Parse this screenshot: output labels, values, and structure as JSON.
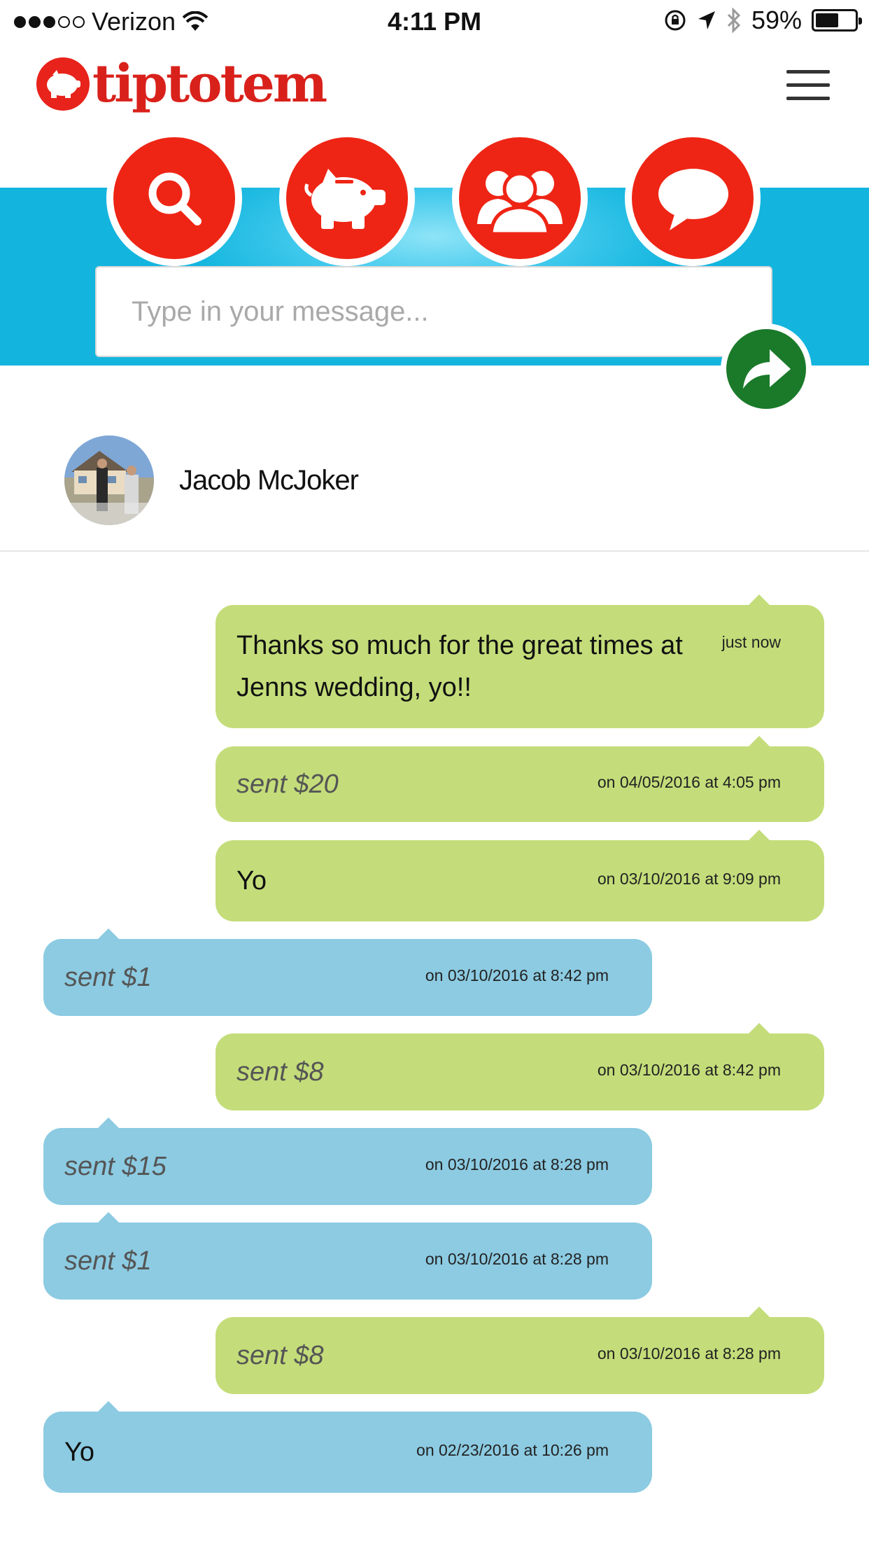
{
  "status_bar": {
    "carrier": "Verizon",
    "time": "4:11 PM",
    "battery": "59%",
    "battery_level": 0.59,
    "signal_bars": 3,
    "signal_total": 5
  },
  "header": {
    "logo_text": "tiptotem"
  },
  "compose": {
    "placeholder": "Type in your message..."
  },
  "contact": {
    "name": "Jacob McJoker"
  },
  "colors": {
    "brand_red": "#ee2515",
    "band_blue": "#13b5de",
    "outgoing_bubble": "#c4dd7a",
    "incoming_bubble": "#8ccbe2",
    "send_green": "#1a7a2a"
  },
  "nav_icons": [
    "search-icon",
    "piggy-bank-icon",
    "group-icon",
    "chat-icon"
  ],
  "messages": [
    {
      "direction": "out",
      "text": "Thanks so much for the great times at Jenns wedding, yo!!",
      "time": "just now"
    },
    {
      "direction": "out",
      "text": "sent $20",
      "time": "on 04/05/2016 at 4:05 pm"
    },
    {
      "direction": "out",
      "text": "Yo",
      "time": "on 03/10/2016 at 9:09 pm"
    },
    {
      "direction": "in",
      "text": "sent $1",
      "time": "on 03/10/2016 at 8:42 pm"
    },
    {
      "direction": "out",
      "text": "sent $8",
      "time": "on 03/10/2016 at 8:42 pm"
    },
    {
      "direction": "in",
      "text": "sent $15",
      "time": "on 03/10/2016 at 8:28 pm"
    },
    {
      "direction": "in",
      "text": "sent $1",
      "time": "on 03/10/2016 at 8:28 pm"
    },
    {
      "direction": "out",
      "text": "sent $8",
      "time": "on 03/10/2016 at 8:28 pm"
    },
    {
      "direction": "in",
      "text": "Yo",
      "time": "on 02/23/2016 at 10:26 pm"
    }
  ]
}
